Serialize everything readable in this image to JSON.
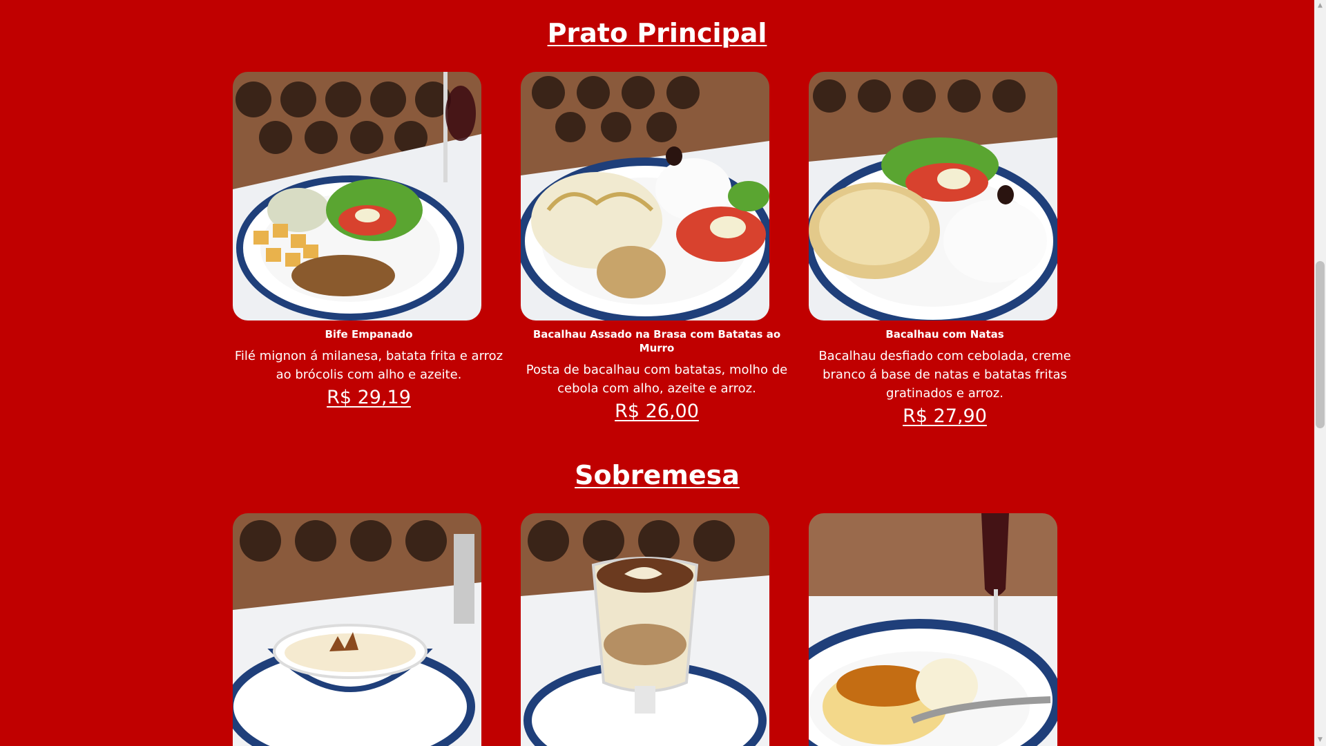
{
  "sections": [
    {
      "title": "Prato Principal",
      "items": [
        {
          "name": "Bife Empanado",
          "description": "Filé mignon á milanesa, batata frita e arroz ao brócolis com alho e azeite.",
          "price": "R$ 29,19",
          "photo_icon": "breaded-steak-plate-photo"
        },
        {
          "name": "Bacalhau Assado na Brasa com Batatas ao Murro",
          "description": "Posta de bacalhau com batatas, molho de cebola com alho, azeite e arroz.",
          "price": "R$ 26,00",
          "photo_icon": "grilled-cod-plate-photo"
        },
        {
          "name": "Bacalhau com Natas",
          "description": "Bacalhau desfiado com cebolada, creme branco á base de natas e batatas fritas gratinados e arroz.",
          "price": "R$ 27,90",
          "photo_icon": "cod-with-cream-plate-photo"
        }
      ]
    },
    {
      "title": "Sobremesa",
      "items": [
        {
          "photo_icon": "custard-cup-photo"
        },
        {
          "photo_icon": "dessert-glass-photo"
        },
        {
          "photo_icon": "flan-plate-photo"
        }
      ]
    }
  ],
  "colors": {
    "background": "#c00000",
    "text": "#ffffff",
    "plate_blue": "#1f3f7a"
  }
}
